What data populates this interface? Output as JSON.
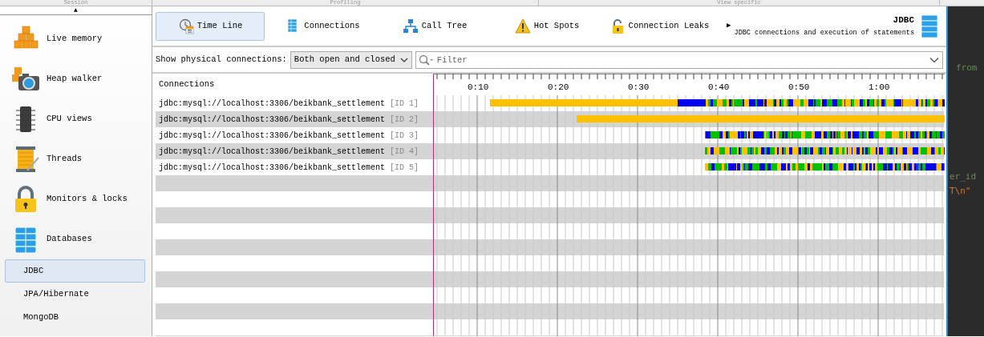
{
  "top_sections": [
    {
      "label": "Session"
    },
    {
      "label": "Profiling"
    },
    {
      "label": "View specific"
    }
  ],
  "sidebar": {
    "scroll_arrow": "▲",
    "items": [
      {
        "label": "Live memory",
        "kind": "category",
        "selected": false
      },
      {
        "label": "Heap walker",
        "kind": "category",
        "selected": false
      },
      {
        "label": "CPU views",
        "kind": "category",
        "selected": false
      },
      {
        "label": "Threads",
        "kind": "category",
        "selected": false
      },
      {
        "label": "Monitors & locks",
        "kind": "category",
        "selected": false
      },
      {
        "label": "Databases",
        "kind": "category",
        "selected": false
      },
      {
        "label": "JDBC",
        "kind": "view",
        "selected": true
      },
      {
        "label": "JPA/Hibernate",
        "kind": "view",
        "selected": false
      },
      {
        "label": "MongoDB",
        "kind": "view",
        "selected": false
      }
    ]
  },
  "tabs": [
    {
      "label": "Time Line",
      "selected": true
    },
    {
      "label": "Connections",
      "selected": false
    },
    {
      "label": "Call Tree",
      "selected": false
    },
    {
      "label": "Hot Spots",
      "selected": false
    },
    {
      "label": "Connection Leaks",
      "selected": false
    }
  ],
  "tabs_overflow_arrow": "▶",
  "view_header": {
    "title": "JDBC",
    "description": "JDBC connections and execution of statements"
  },
  "filter_bar": {
    "label": "Show physical connections:",
    "select_value": "Both open and closed",
    "placeholder": "Filter"
  },
  "timeline": {
    "column_header": "Connections",
    "time_labels": [
      "0:10",
      "0:20",
      "0:30",
      "0:40",
      "0:50",
      "1:00"
    ],
    "rows": [
      {
        "url": "jdbc:mysql://localhost:3306/beikbank_settlement",
        "id": "[ID 1]",
        "kind": "mixed",
        "level": 0.89
      },
      {
        "url": "jdbc:mysql://localhost:3306/beikbank_settlement",
        "id": "[ID 2]",
        "kind": "idle",
        "level": 0.72
      },
      {
        "url": "jdbc:mysql://localhost:3306/beikbank_settlement",
        "id": "[ID 3]",
        "kind": "active",
        "level": 0.47
      },
      {
        "url": "jdbc:mysql://localhost:3306/beikbank_settlement",
        "id": "[ID 4]",
        "kind": "active",
        "level": 0.47
      },
      {
        "url": "jdbc:mysql://localhost:3306/beikbank_settlement",
        "id": "[ID 5]",
        "kind": "active",
        "level": 0.47
      }
    ]
  },
  "editor": {
    "lines": [
      {
        "text": "from",
        "color": "#6a8759"
      },
      {
        "text": "er_id",
        "color": "#6a8759"
      },
      {
        "text": "T\\n\"",
        "color": "#cc7832"
      }
    ]
  }
}
